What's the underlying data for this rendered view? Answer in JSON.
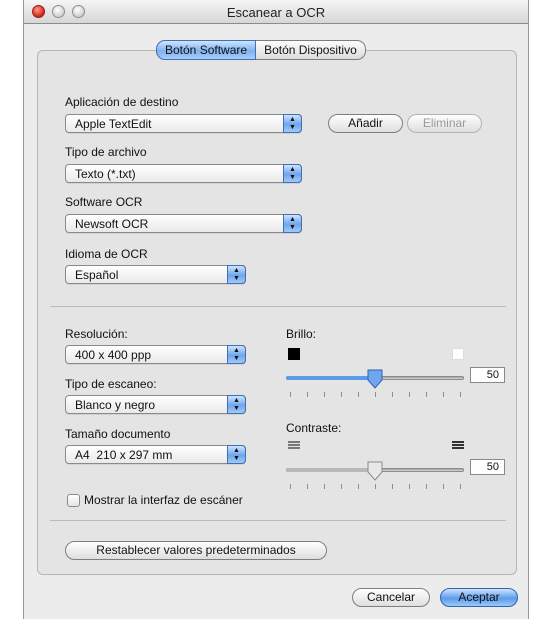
{
  "window": {
    "title": "Escanear a OCR"
  },
  "tabs": [
    {
      "label": "Botón Software",
      "active": true
    },
    {
      "label": "Botón Dispositivo",
      "active": false
    }
  ],
  "destination": {
    "label": "Aplicación de destino",
    "value": "Apple TextEdit",
    "add_label": "Añadir",
    "remove_label": "Eliminar"
  },
  "file_type": {
    "label": "Tipo de archivo",
    "value": "Texto (*.txt)"
  },
  "ocr_software": {
    "label": "Software OCR",
    "value": "Newsoft OCR"
  },
  "ocr_language": {
    "label": "Idioma de OCR",
    "value": "Español"
  },
  "resolution": {
    "label": "Resolución:",
    "value": "400 x 400 ppp"
  },
  "scan_type": {
    "label": "Tipo de escaneo:",
    "value": "Blanco y negro"
  },
  "document_size": {
    "label": "Tamaño documento",
    "value": "A4  210 x 297 mm"
  },
  "brightness": {
    "label": "Brillo:",
    "value": "50",
    "level": 0.5
  },
  "contrast": {
    "label": "Contraste:",
    "value": "50",
    "level": 0.5
  },
  "show_interface": {
    "label": "Mostrar la interfaz de escáner",
    "checked": false
  },
  "restore_label": "Restablecer valores predeterminados",
  "footer": {
    "cancel_label": "Cancelar",
    "accept_label": "Aceptar"
  },
  "colors": {
    "accent": "#5c9bea",
    "window_bg": "#ececec"
  }
}
